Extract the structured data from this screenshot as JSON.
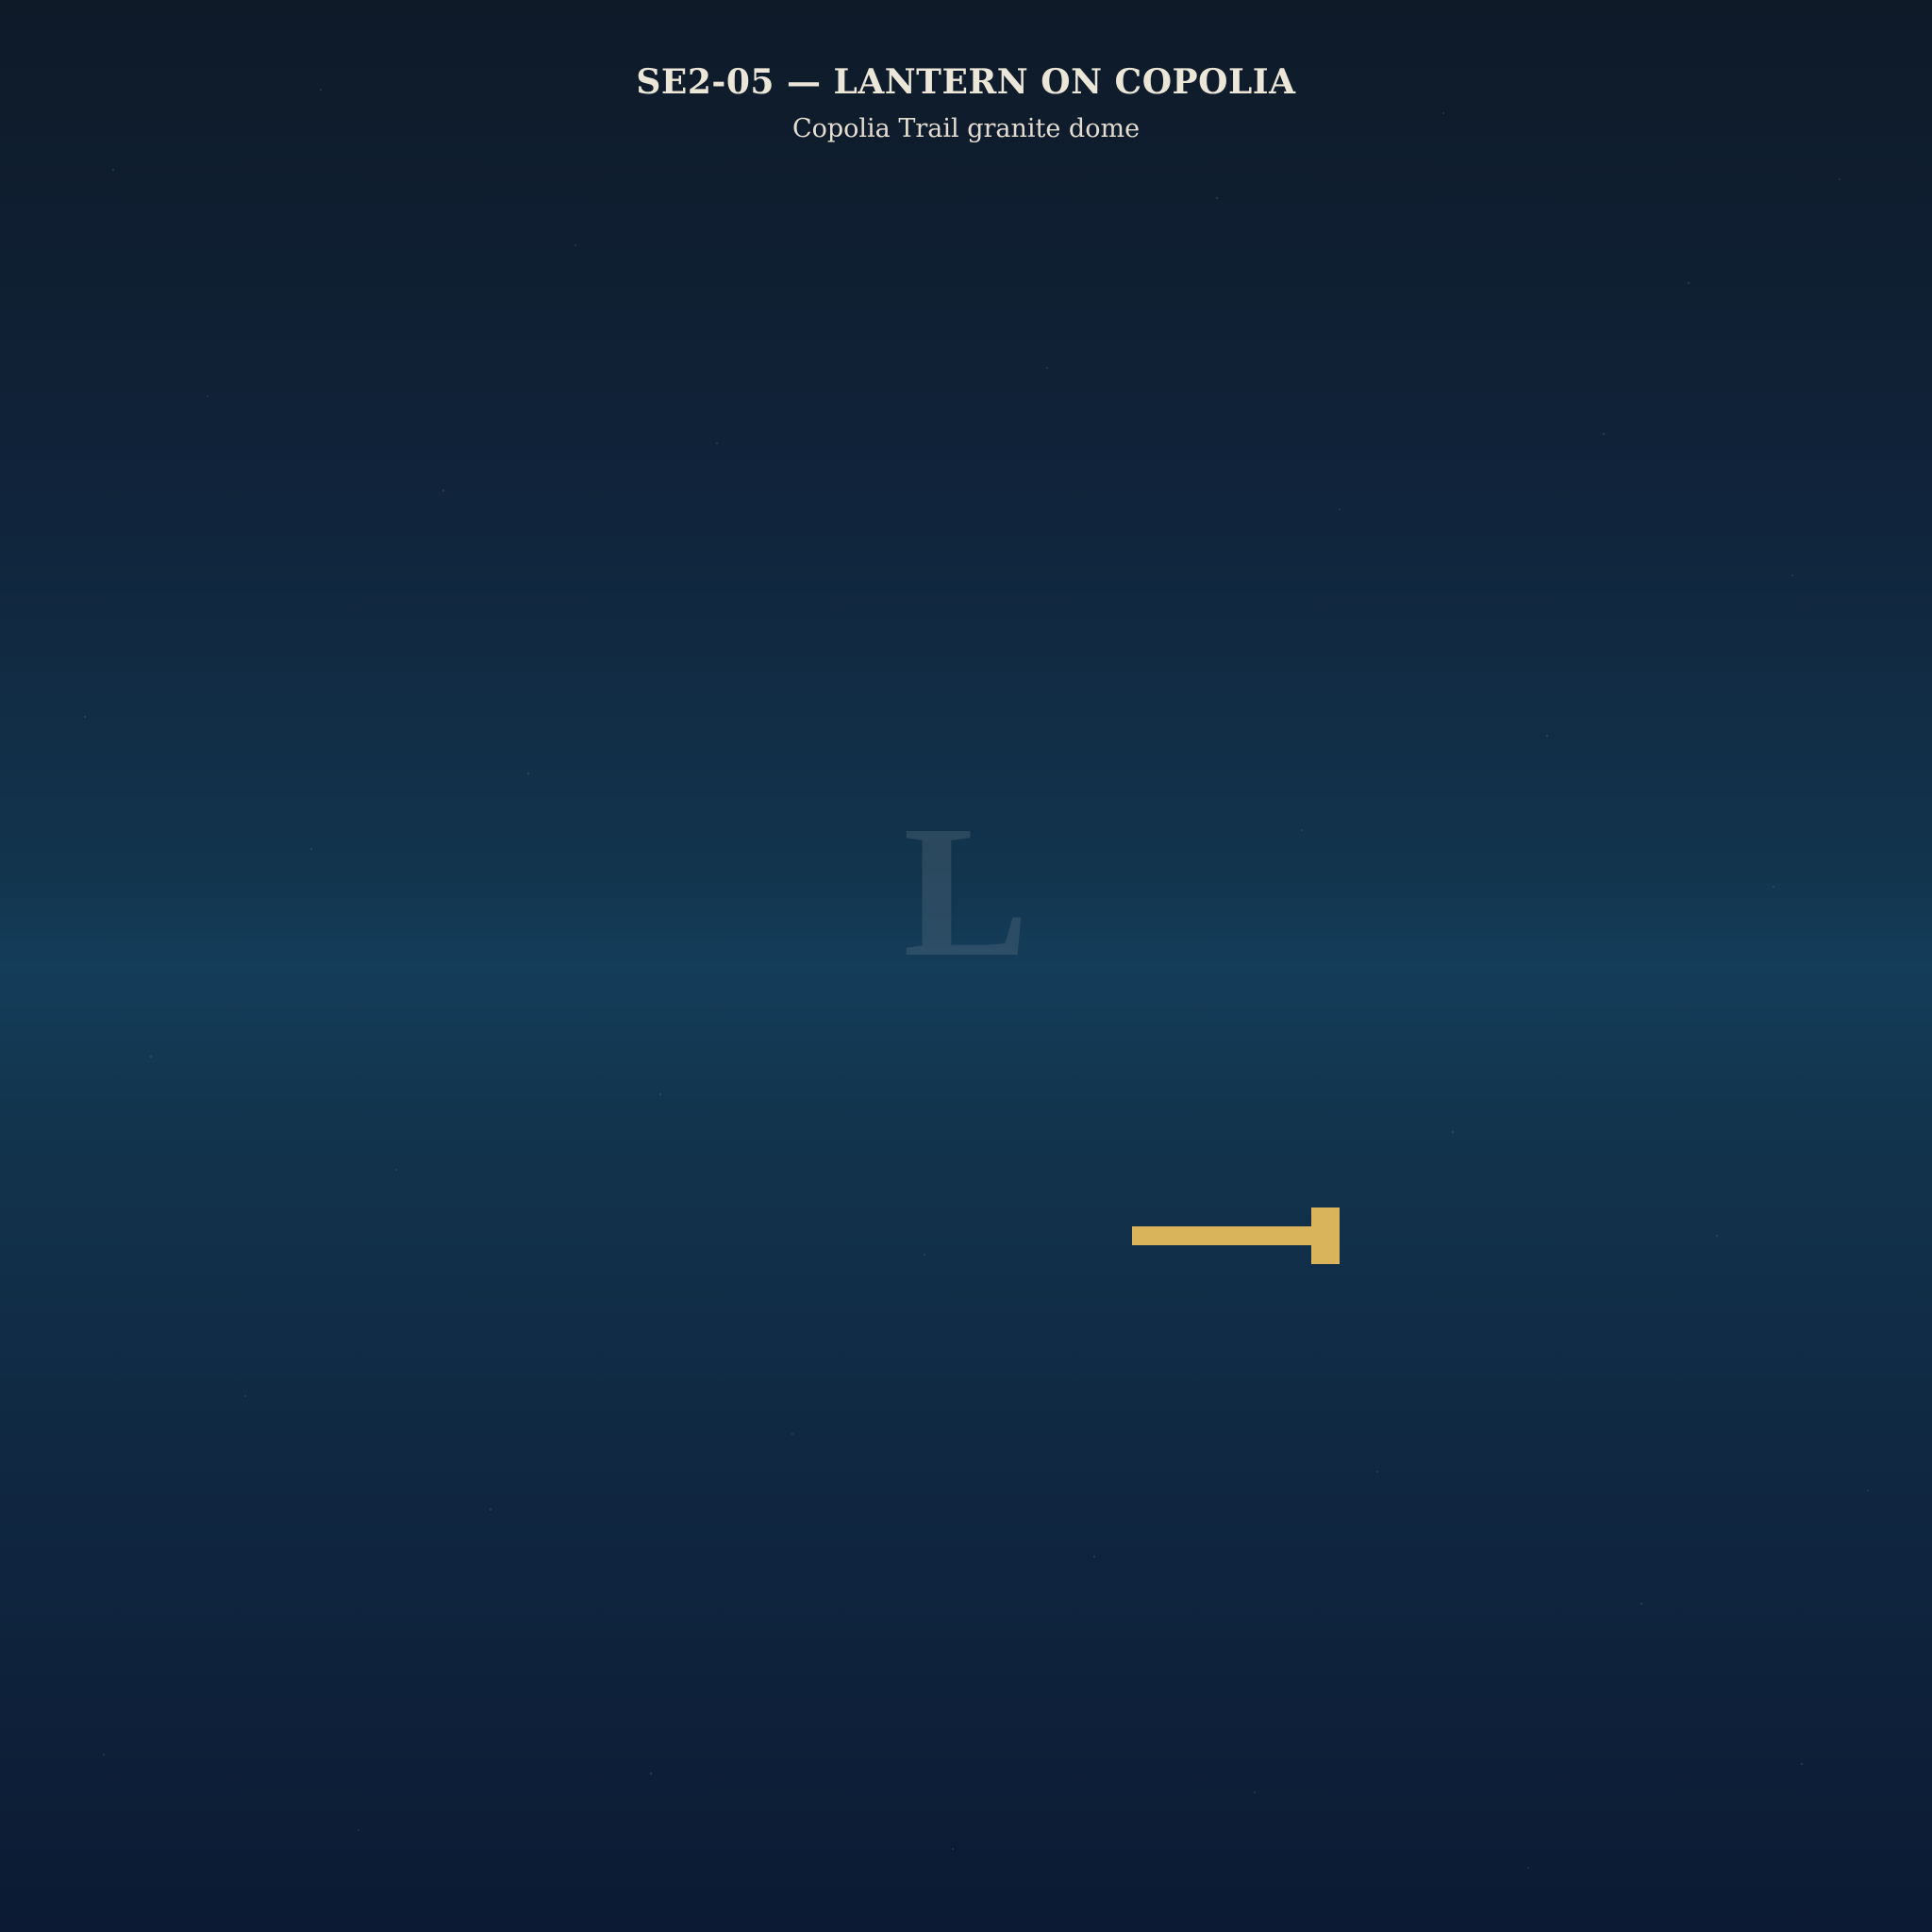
{
  "header": {
    "title": "SE2-05 — LANTERN ON COPOLIA",
    "subtitle": "Copolia Trail granite dome"
  },
  "scene": {
    "glyph": "L",
    "glyph_color": "#5b7080",
    "marker_color": "#d9b45a",
    "background_top": "#0e1a28",
    "background_mid": "#143d5a",
    "background_bottom": "#0c1a33",
    "marker_icon": "hammer-icon"
  }
}
